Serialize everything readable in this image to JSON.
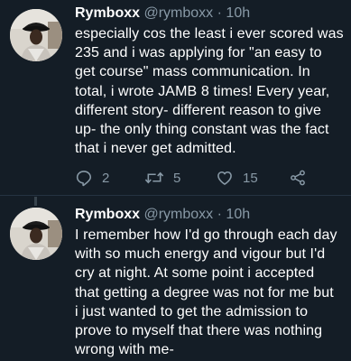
{
  "tweets": [
    {
      "author": {
        "name": "Rymboxx",
        "handle": "@rymboxx",
        "separator": "·",
        "time": "10h"
      },
      "lines": [
        "especially cos the least i ever scored was",
        "235 and i was applying for \"an easy to",
        "get course\" mass communication. In",
        "total, i wrote JAMB 8 times! Every year,",
        "different story- different reason to give",
        "up- the only thing constant was the fact",
        "that i never get admitted."
      ],
      "actions": {
        "replies": "2",
        "retweets": "5",
        "likes": "15"
      }
    },
    {
      "author": {
        "name": "Rymboxx",
        "handle": "@rymboxx",
        "separator": "·",
        "time": "10h"
      },
      "lines": [
        "I remember how I'd go through each day",
        "with so much energy and vigour but I'd",
        "cry at night. At some point i accepted",
        "that getting a degree was not for me but",
        "i just wanted to get the admission to",
        "prove to myself that there was nothing",
        "wrong with me-"
      ]
    }
  ],
  "icons": {
    "reply": "reply-icon",
    "retweet": "retweet-icon",
    "like": "heart-icon",
    "share": "share-icon"
  },
  "colors": {
    "background": "#141d26",
    "text": "#ffffff",
    "secondary": "#8899a6",
    "divider": "#253341"
  }
}
